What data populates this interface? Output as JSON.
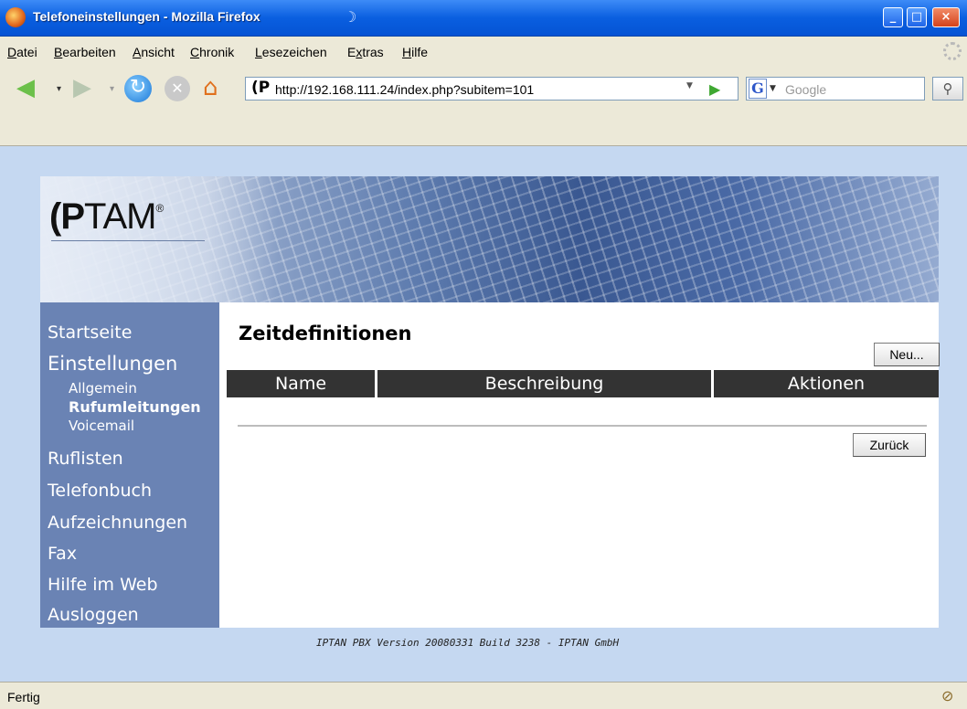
{
  "window": {
    "title": "Telefoneinstellungen - Mozilla Firefox",
    "moon_glyph": "☽",
    "minimize": "_",
    "maximize": "□",
    "close": "×"
  },
  "menubar": {
    "items": [
      {
        "u": "D",
        "rest": "atei"
      },
      {
        "u": "B",
        "rest": "earbeiten"
      },
      {
        "u": "A",
        "rest": "nsicht"
      },
      {
        "u": "C",
        "rest": "hronik"
      },
      {
        "u": "L",
        "rest": "esezeichen"
      },
      {
        "pre": "E",
        "u": "x",
        "rest": "tras"
      },
      {
        "u": "H",
        "rest": "ilfe"
      }
    ]
  },
  "toolbar": {
    "back_icon": "back-arrow-icon",
    "forward_icon": "forward-arrow-icon",
    "url": "http://192.168.111.24/index.php?subitem=101",
    "favicon": "(P",
    "search_engine": "G",
    "search_placeholder": "Google"
  },
  "banner": {
    "logo_bold": "(P",
    "logo_thin": "TAM",
    "logo_reg": "®"
  },
  "sidebar": {
    "items": [
      {
        "label": "Startseite"
      },
      {
        "label": "Einstellungen"
      },
      {
        "label": "Allgemein"
      },
      {
        "label": "Rufumleitungen"
      },
      {
        "label": "Voicemail"
      },
      {
        "label": "Ruflisten"
      },
      {
        "label": "Telefonbuch"
      },
      {
        "label": "Aufzeichnungen"
      },
      {
        "label": "Fax"
      },
      {
        "label": "Hilfe im Web"
      },
      {
        "label": "Ausloggen"
      }
    ]
  },
  "main": {
    "title": "Zeitdefinitionen",
    "new_button": "Neu...",
    "back_button": "Zurück",
    "columns": [
      "Name",
      "Beschreibung",
      "Aktionen"
    ]
  },
  "footer": {
    "text": "IPTAN PBX Version 20080331 Build 3238 - IPTAN GmbH"
  },
  "statusbar": {
    "text": "Fertig"
  }
}
